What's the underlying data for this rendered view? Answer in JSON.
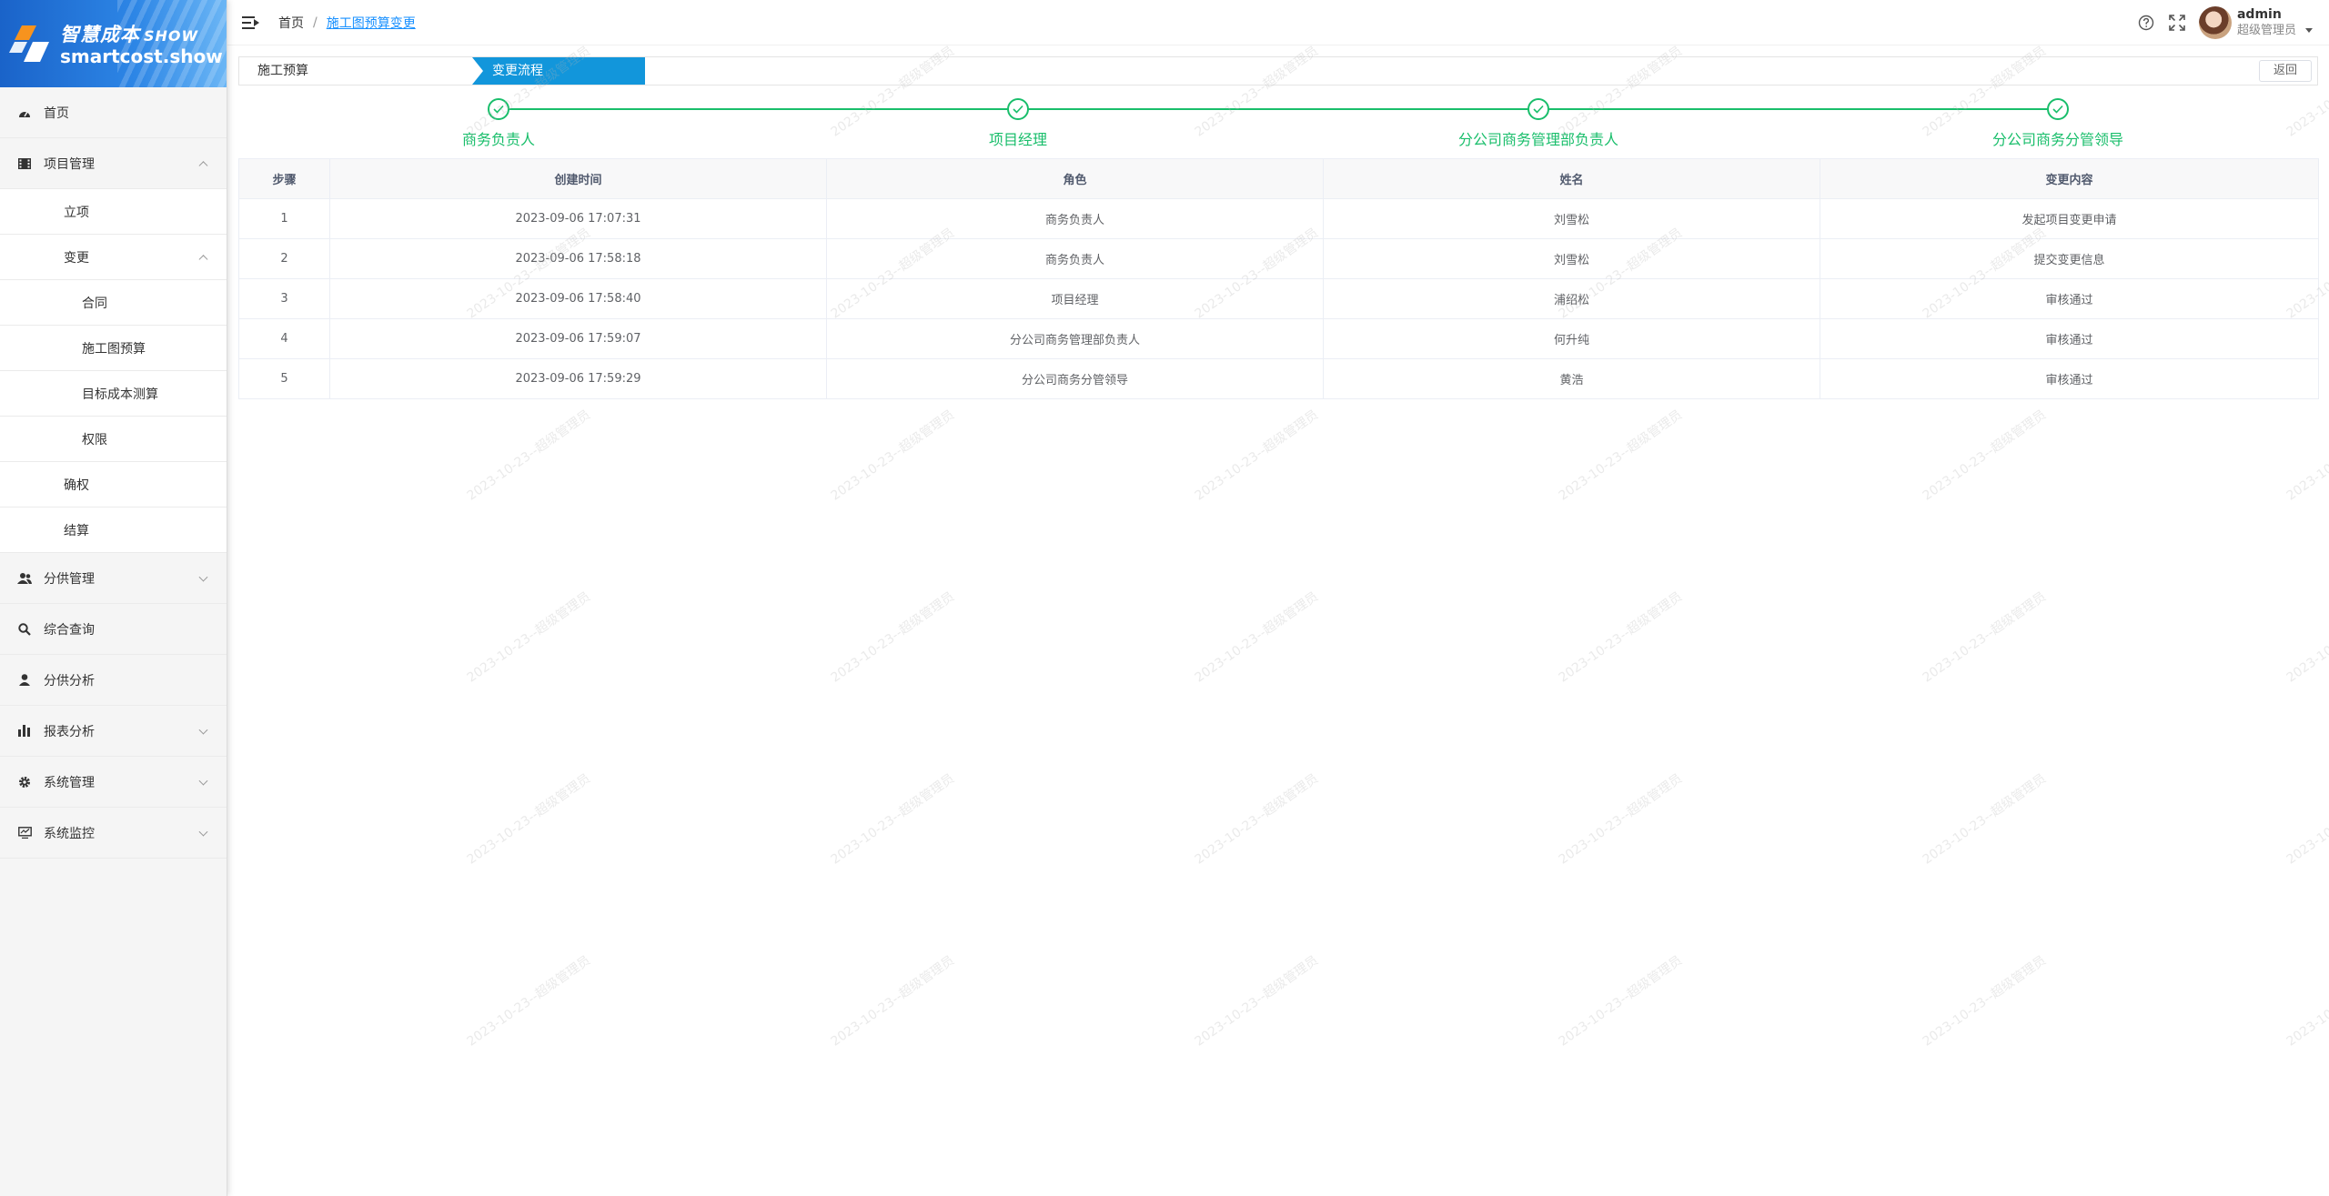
{
  "brand": {
    "name_cn": "智慧成本",
    "name_show": "SHOW",
    "domain": "smartcost.show"
  },
  "sidebar": {
    "items": [
      {
        "label": "首页",
        "icon": "dashboard-icon",
        "level": 0
      },
      {
        "label": "项目管理",
        "icon": "film-icon",
        "level": 0,
        "expanded": true
      },
      {
        "label": "立项",
        "level": 1
      },
      {
        "label": "变更",
        "level": 1,
        "expanded": true
      },
      {
        "label": "合同",
        "level": 2
      },
      {
        "label": "施工图预算",
        "level": 2
      },
      {
        "label": "目标成本测算",
        "level": 2
      },
      {
        "label": "权限",
        "level": 2
      },
      {
        "label": "确权",
        "level": 1
      },
      {
        "label": "结算",
        "level": 1
      },
      {
        "label": "分供管理",
        "icon": "users-icon",
        "level": 0
      },
      {
        "label": "综合查询",
        "icon": "search-icon",
        "level": 0
      },
      {
        "label": "分供分析",
        "icon": "user-icon",
        "level": 0
      },
      {
        "label": "报表分析",
        "icon": "bar-chart-icon",
        "level": 0
      },
      {
        "label": "系统管理",
        "icon": "gear-icon",
        "level": 0
      },
      {
        "label": "系统监控",
        "icon": "monitor-icon",
        "level": 0
      }
    ]
  },
  "header": {
    "breadcrumb_home": "首页",
    "breadcrumb_sep": "/",
    "breadcrumb_current": "施工图预算变更",
    "user_name": "admin",
    "user_role": "超级管理员"
  },
  "tabs": {
    "first": "施工预算",
    "active": "变更流程",
    "back": "返回"
  },
  "steps": [
    "商务负责人",
    "项目经理",
    "分公司商务管理部负责人",
    "分公司商务分管领导"
  ],
  "table": {
    "columns": [
      "步骤",
      "创建时间",
      "角色",
      "姓名",
      "变更内容"
    ],
    "rows": [
      [
        "1",
        "2023-09-06 17:07:31",
        "商务负责人",
        "刘雪松",
        "发起项目变更申请"
      ],
      [
        "2",
        "2023-09-06 17:58:18",
        "商务负责人",
        "刘雪松",
        "提交变更信息"
      ],
      [
        "3",
        "2023-09-06 17:58:40",
        "项目经理",
        "浦绍松",
        "审核通过"
      ],
      [
        "4",
        "2023-09-06 17:59:07",
        "分公司商务管理部负责人",
        "何升纯",
        "审核通过"
      ],
      [
        "5",
        "2023-09-06 17:59:29",
        "分公司商务分管领导",
        "黄浩",
        "审核通过"
      ]
    ]
  },
  "watermark_text": "2023-10-23--超级管理员",
  "colors": {
    "accent": "#1890ff",
    "tab_active": "#1296db",
    "step_success": "#19be6b"
  }
}
